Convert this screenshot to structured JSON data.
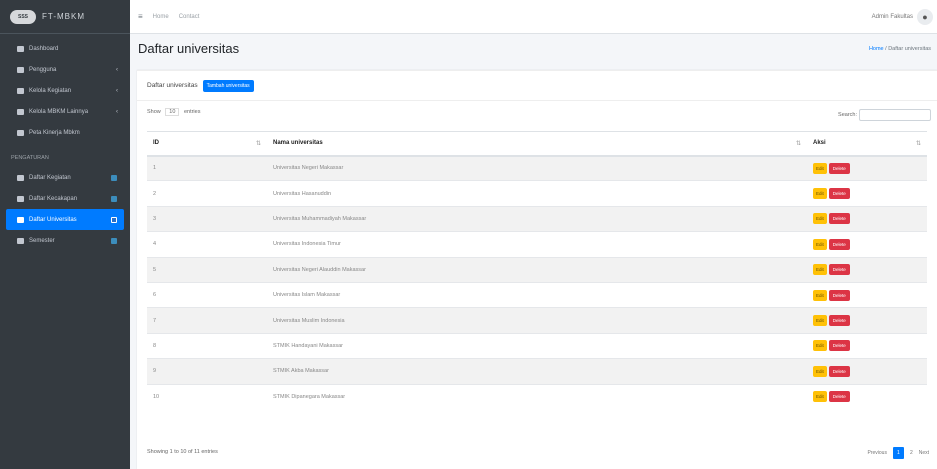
{
  "brand": {
    "logo_text": "SSS",
    "name": "FT-MBKM"
  },
  "sidebar": {
    "items": [
      {
        "label": "Dashboard",
        "chevron": "",
        "dot": false,
        "active": false
      },
      {
        "label": "Pengguna",
        "chevron": "‹",
        "dot": false,
        "active": false
      },
      {
        "label": "Kelola Kegiatan",
        "chevron": "‹",
        "dot": false,
        "active": false
      },
      {
        "label": "Kelola MBKM Lainnya",
        "chevron": "‹",
        "dot": false,
        "active": false
      },
      {
        "label": "Peta Kinerja Mbkm",
        "chevron": "",
        "dot": false,
        "active": false
      }
    ],
    "header": "Pengaturan",
    "items2": [
      {
        "label": "Daftar Kegiatan",
        "dot": true,
        "active": false
      },
      {
        "label": "Daftar Kecakapan",
        "dot": true,
        "active": false
      },
      {
        "label": "Daftar Universitas",
        "dot": true,
        "active": true
      },
      {
        "label": "Semester",
        "dot": true,
        "active": false
      }
    ]
  },
  "topbar": {
    "menu_icon": "≡",
    "link1": "Home",
    "link2": "Contact",
    "user_name": "Admin Fakultas"
  },
  "page": {
    "title": "Daftar universitas",
    "breadcrumb_home": "Home",
    "breadcrumb_sep": " / ",
    "breadcrumb_current": "Daftar universitas"
  },
  "card": {
    "title": "Daftar universitas",
    "add_button": "Tambah universitas",
    "show_prefix": "Show",
    "show_value": "10",
    "show_suffix": "entries",
    "search_label": "Search:",
    "columns": [
      "ID",
      "Nama universitas",
      "Aksi"
    ],
    "edit_label": "Edit",
    "delete_label": "Delete",
    "rows": [
      {
        "id": "1",
        "name": "Universitas Negeri Makassar"
      },
      {
        "id": "2",
        "name": "Universitas Hasanuddin"
      },
      {
        "id": "3",
        "name": "Universitas Muhammadiyah Makassar"
      },
      {
        "id": "4",
        "name": "Universitas Indonesia Timur"
      },
      {
        "id": "5",
        "name": "Universitas Negeri Alauddin Makassar"
      },
      {
        "id": "6",
        "name": "Universitas Islam Makassar"
      },
      {
        "id": "7",
        "name": "Universitas Muslim Indonesia"
      },
      {
        "id": "8",
        "name": "STMIK Handayani Makassar"
      },
      {
        "id": "9",
        "name": "STMIK Akba Makassar"
      },
      {
        "id": "10",
        "name": "STMIK Dipanegara Makassar"
      }
    ],
    "info": "Showing 1 to 10 of 11 entries",
    "pager": {
      "prev": "Previous",
      "p1": "1",
      "p2": "2",
      "next": "Next"
    }
  }
}
